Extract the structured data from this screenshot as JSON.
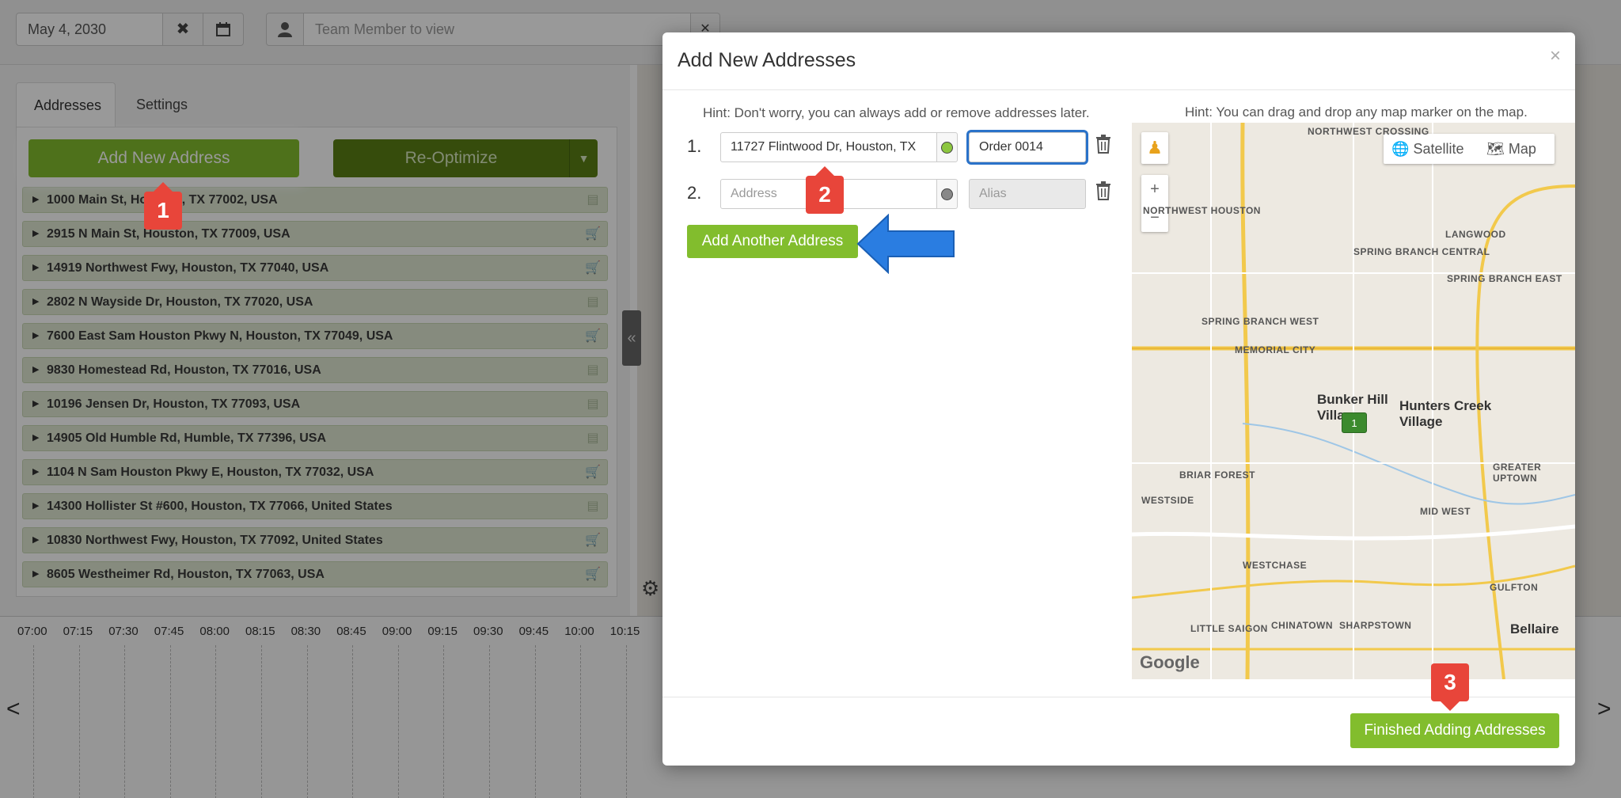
{
  "topbar": {
    "date_value": "May 4, 2030",
    "member_placeholder": "Team Member to view"
  },
  "left_panel": {
    "tabs": [
      "Addresses",
      "Settings"
    ],
    "add_address_label": "Add New Address",
    "reoptimize_label": "Re-Optimize",
    "addresses": [
      {
        "text": "1000 Main St, Houston, TX 77002, USA",
        "icon": "clipboard-icon"
      },
      {
        "text": "2915 N Main St, Houston, TX 77009, USA",
        "icon": "cart-icon"
      },
      {
        "text": "14919 Northwest Fwy, Houston, TX 77040, USA",
        "icon": "cart-icon"
      },
      {
        "text": "2802 N Wayside Dr, Houston, TX 77020, USA",
        "icon": "clipboard-icon"
      },
      {
        "text": "7600 East Sam Houston Pkwy N, Houston, TX 77049, USA",
        "icon": "cart-icon"
      },
      {
        "text": "9830 Homestead Rd, Houston, TX 77016, USA",
        "icon": "clipboard-icon"
      },
      {
        "text": "10196 Jensen Dr, Houston, TX 77093, USA",
        "icon": "clipboard-icon"
      },
      {
        "text": "14905 Old Humble Rd, Humble, TX 77396, USA",
        "icon": "clipboard-icon"
      },
      {
        "text": "1104 N Sam Houston Pkwy E, Houston, TX 77032, USA",
        "icon": "cart-icon"
      },
      {
        "text": "14300 Hollister St #600, Houston, TX 77066, United States",
        "icon": "clipboard-icon"
      },
      {
        "text": "10830 Northwest Fwy, Houston, TX 77092, United States",
        "icon": "cart-icon"
      },
      {
        "text": "8605 Westheimer Rd, Houston, TX 77063, USA",
        "icon": "cart-icon"
      }
    ]
  },
  "timeline": {
    "ticks": [
      "07:00",
      "07:15",
      "07:30",
      "07:45",
      "08:00",
      "08:15",
      "08:30",
      "08:45",
      "09:00",
      "09:15",
      "09:30",
      "09:45",
      "10:00",
      "10:15"
    ],
    "prev": "<",
    "next": ">"
  },
  "modal": {
    "title": "Add New Addresses",
    "close": "×",
    "hint_left": "Hint: Don't worry, you can always add or remove addresses later.",
    "hint_right": "Hint: You can drag and drop any map marker on the map.",
    "rows": [
      {
        "num": "1.",
        "address_value": "11727 Flintwood Dr, Houston, TX",
        "alias_value": "Order 0014"
      },
      {
        "num": "2.",
        "address_placeholder": "Address",
        "alias_placeholder": "Alias"
      }
    ],
    "add_another_label": "Add Another Address",
    "finished_label": "Finished Adding Addresses",
    "map": {
      "satellite_label": "Satellite",
      "map_label": "Map",
      "zoom_in": "+",
      "zoom_out": "−",
      "marker_label": "1",
      "google": "Google",
      "places": [
        "Northwest Crossing",
        "Langwood",
        "Northwest Houston",
        "Spring Branch Central",
        "Spring Branch East",
        "Spring Branch West",
        "Memorial City",
        "Bunker Hill Village",
        "Hunters Creek Village",
        "Briar Forest",
        "Westside",
        "Greater Uptown",
        "Mid West",
        "Westchase",
        "Gulfton",
        "Little Saigon",
        "Chinatown",
        "Sharpstown",
        "Bellaire"
      ]
    }
  },
  "annotations": {
    "badge_1": "1",
    "badge_2": "2",
    "badge_3": "3"
  },
  "colors": {
    "accent_green": "#82bd2d",
    "dark_green": "#5a7f14",
    "badge_red": "#e8453a",
    "arrow_blue": "#2a7de1",
    "alias_focus": "#2a72c9"
  }
}
